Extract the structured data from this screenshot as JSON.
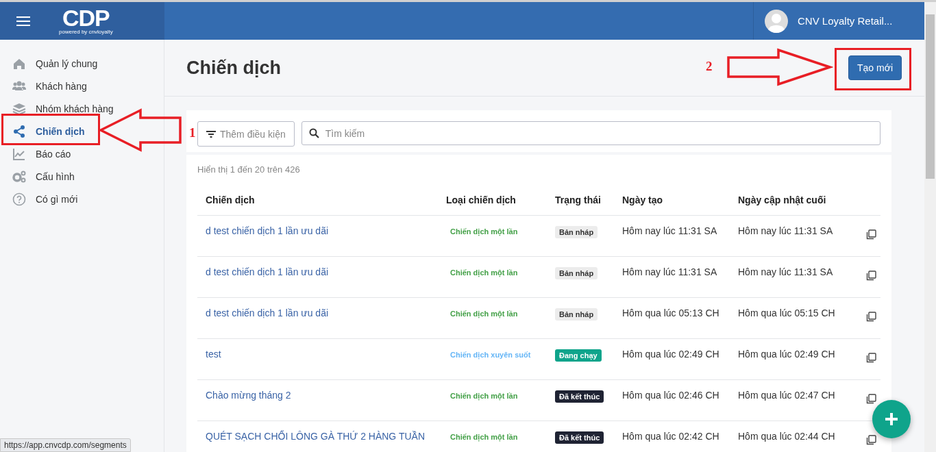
{
  "topbar": {
    "logo": "CDP",
    "logo_tagline": "powered by cnvloyalty",
    "user_name": "CNV Loyalty Retail..."
  },
  "sidebar": {
    "items": [
      {
        "label": "Quản lý chung",
        "selected": false
      },
      {
        "label": "Khách hàng",
        "selected": false
      },
      {
        "label": "Nhóm khách hàng",
        "selected": false
      },
      {
        "label": "Chiến dịch",
        "selected": true
      },
      {
        "label": "Báo cáo",
        "selected": false
      },
      {
        "label": "Cấu hình",
        "selected": false
      },
      {
        "label": "Có gì mới",
        "selected": false
      }
    ]
  },
  "page": {
    "title": "Chiến dịch",
    "create_button": "Tạo mới"
  },
  "filter": {
    "add_condition": "Thêm điều kiện",
    "search_placeholder": "Tìm kiếm"
  },
  "table": {
    "summary": "Hiển thị 1 đến 20 trên 426",
    "columns": [
      "Chiến dịch",
      "Loại chiến dịch",
      "Trạng thái",
      "Ngày tạo",
      "Ngày cập nhật cuối"
    ],
    "rows": [
      {
        "name": "d test chiến dịch 1 lần ưu dãi",
        "type": {
          "label": "Chiến dịch một lần",
          "color": "#43a047"
        },
        "status": {
          "label": "Bản nháp",
          "color": "#ececec"
        },
        "created": "Hôm nay lúc 11:31 SA",
        "updated": "Hôm nay lúc 11:31 SA"
      },
      {
        "name": "d test chiến dịch 1 lần ưu dãi",
        "type": {
          "label": "Chiến dịch một lần",
          "color": "#43a047"
        },
        "status": {
          "label": "Bản nháp",
          "color": "#ececec"
        },
        "created": "Hôm nay lúc 11:31 SA",
        "updated": "Hôm nay lúc 11:31 SA"
      },
      {
        "name": "d test chiến dịch 1 lần ưu dãi",
        "type": {
          "label": "Chiến dịch một lần",
          "color": "#43a047"
        },
        "status": {
          "label": "Bản nháp",
          "color": "#ececec"
        },
        "created": "Hôm qua lúc 05:13 CH",
        "updated": "Hôm qua lúc 05:15 CH"
      },
      {
        "name": "test",
        "type": {
          "label": "Chiến dịch xuyên suốt",
          "color": "#64b5f6"
        },
        "status": {
          "label": "Đang chạy",
          "color": "#0fa48b"
        },
        "created": "Hôm qua lúc 02:49 CH",
        "updated": "Hôm qua lúc 02:49 CH"
      },
      {
        "name": "Chào mừng tháng 2",
        "type": {
          "label": "Chiến dịch một lần",
          "color": "#43a047"
        },
        "status": {
          "label": "Đã kết thúc",
          "color": "#1f2333"
        },
        "created": "Hôm qua lúc 02:46 CH",
        "updated": "Hôm qua lúc 02:47 CH"
      },
      {
        "name": "QUÉT SẠCH CHỔI LÔNG GÀ THỨ 2 HÀNG TUẦN",
        "type": {
          "label": "Chiến dịch một lần",
          "color": "#43a047"
        },
        "status": {
          "label": "Đã kết thúc",
          "color": "#1f2333"
        },
        "created": "Hôm qua lúc 02:42 CH",
        "updated": "Hôm qua lúc 02:44 CH"
      }
    ]
  },
  "annotations": [
    {
      "label": "1"
    },
    {
      "label": "2"
    }
  ],
  "status_url": "https://app.cnvcdp.com/segments"
}
